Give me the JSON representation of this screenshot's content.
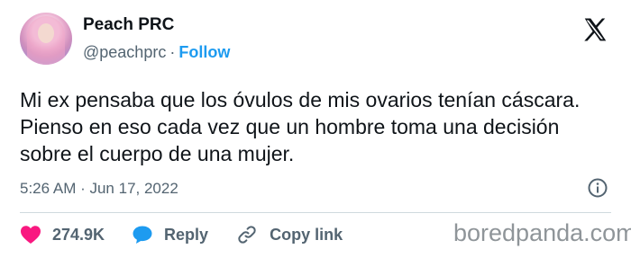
{
  "author": {
    "display_name": "Peach PRC",
    "handle": "@peachprc",
    "separator": "·",
    "follow_label": "Follow"
  },
  "tweet": {
    "text": "Mi ex pensaba que los óvulos de mis ovarios tenían cáscara. Pienso en eso cada vez que un hombre toma una decisión sobre el cuerpo de una mujer.",
    "timestamp": "5:26 AM · Jun 17, 2022"
  },
  "actions": {
    "likes": "274.9K",
    "reply_label": "Reply",
    "copy_link_label": "Copy link"
  },
  "watermark": "boredpanda.com",
  "icons": {
    "platform": "x-logo-icon",
    "like": "heart-icon",
    "reply": "speech-bubble-icon",
    "copy": "link-icon",
    "info": "info-icon"
  },
  "colors": {
    "like": "#f91880",
    "reply": "#1d9bf0",
    "follow": "#1d9bf0",
    "secondary_text": "#536471"
  }
}
